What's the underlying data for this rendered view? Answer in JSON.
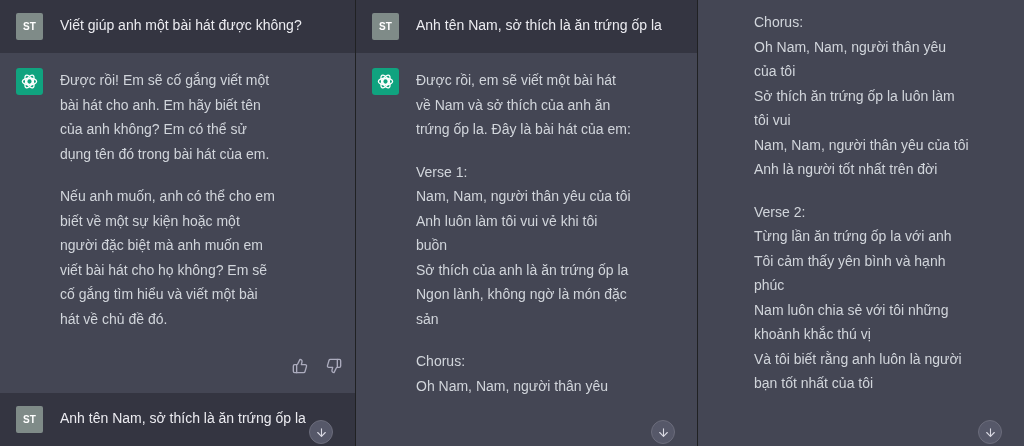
{
  "panels": [
    {
      "messages": [
        {
          "kind": "user",
          "avatar": "ST",
          "paragraphs": [
            [
              "Viết giúp anh một bài hát được không?"
            ]
          ]
        },
        {
          "kind": "assistant",
          "feedback_icons": true,
          "paragraphs": [
            [
              "Được rồi! Em sẽ cố gắng viết một bài hát cho anh. Em hãy biết tên của anh không? Em có thể sử dụng tên đó trong bài hát của em."
            ],
            [
              "Nếu anh muốn, anh có thể cho em biết về một sự kiện hoặc một người đặc biệt mà anh muốn em viết bài hát cho họ không? Em sẽ cố gắng tìm hiểu và viết một bài hát về chủ đề đó."
            ]
          ]
        },
        {
          "kind": "user",
          "avatar": "ST",
          "paragraphs": [
            [
              "Anh tên Nam, sở thích là ăn trứng ốp la"
            ]
          ]
        }
      ]
    },
    {
      "messages": [
        {
          "kind": "user",
          "avatar": "ST",
          "paragraphs": [
            [
              "Anh tên Nam, sở thích là ăn trứng ốp la"
            ]
          ]
        },
        {
          "kind": "assistant",
          "paragraphs": [
            [
              "Được rồi, em sẽ viết một bài hát về Nam và sở thích của anh ăn trứng ốp la. Đây là bài hát của em:"
            ],
            [
              "Verse 1:",
              "Nam, Nam, người thân yêu của tôi",
              "Anh luôn làm tôi vui vẻ khi tôi buồn",
              "Sở thích của anh là ăn trứng ốp la",
              "Ngon lành, không ngờ là món đặc sản"
            ],
            [
              "Chorus:",
              "Oh Nam, Nam, người thân yêu"
            ]
          ]
        }
      ]
    },
    {
      "messages": [
        {
          "kind": "continuation",
          "paragraphs": [
            [
              "Chorus:",
              "Oh Nam, Nam, người thân yêu của tôi",
              "Sở thích ăn trứng ốp la luôn làm tôi vui",
              "Nam, Nam, người thân yêu của tôi",
              "Anh là người tốt nhất trên đời"
            ],
            [
              "Verse 2:",
              "Từng lần ăn trứng ốp la với anh",
              "Tôi cảm thấy yên bình và hạnh phúc",
              "Nam luôn chia sẻ với tôi những khoảnh khắc thú vị",
              "Và tôi biết rằng anh luôn là người bạn tốt nhất của tôi"
            ]
          ]
        }
      ]
    }
  ]
}
